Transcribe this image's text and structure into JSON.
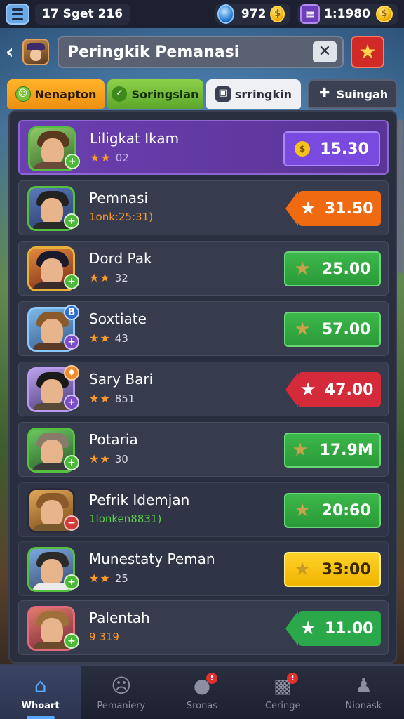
{
  "status_bar": {
    "title": "17 Sget 216",
    "gems": "972",
    "gold": "1:1980"
  },
  "header": {
    "search_value": "Peringkik Pemanasi",
    "clear_icon": "close-icon",
    "fav_icon": "star-icon"
  },
  "tabs": [
    {
      "label": "Nenapton",
      "icon": "smile-icon"
    },
    {
      "label": "Soringslan",
      "icon": "check-icon"
    },
    {
      "label": "srringkin",
      "icon": "grid-icon"
    },
    {
      "label": "Suingah",
      "icon": "plus-icon"
    }
  ],
  "rows": [
    {
      "name": "Liligkat Ikam",
      "sub": "★★ 02",
      "price": "15.30",
      "price_style": "purple",
      "sub_style": ""
    },
    {
      "name": "Pemnasi",
      "sub": "1onk:25:31)",
      "price": "31.50",
      "price_style": "orange-tag",
      "sub_style": "orange"
    },
    {
      "name": "Dord Pak",
      "sub": "★★ 32",
      "price": "25.00",
      "price_style": "green",
      "sub_style": ""
    },
    {
      "name": "Soxtiate",
      "sub": "★★ 43",
      "price": "57.00",
      "price_style": "green",
      "sub_style": ""
    },
    {
      "name": "Sary Bari",
      "sub": "★★ 851",
      "price": "47.00",
      "price_style": "red-tag",
      "sub_style": ""
    },
    {
      "name": "Potaria",
      "sub": "★★ 30",
      "price": "17.9M",
      "price_style": "green",
      "sub_style": ""
    },
    {
      "name": "Pefrik Idemjan",
      "sub": "1lonken8831)",
      "price": "20:60",
      "price_style": "green",
      "sub_style": "green"
    },
    {
      "name": "Munestaty Peman",
      "sub": "★★ 25",
      "price": "33:00",
      "price_style": "yellow",
      "sub_style": ""
    },
    {
      "name": "Palentah",
      "sub": "9 319",
      "price": "11.00",
      "price_style": "green-tag",
      "sub_style": "orange"
    }
  ],
  "bottom_nav": [
    {
      "label": "Whoart",
      "icon": "home-icon",
      "active": true
    },
    {
      "label": "Pemaniery",
      "icon": "face-icon",
      "active": false
    },
    {
      "label": "Sronas",
      "icon": "chat-icon",
      "active": false
    },
    {
      "label": "Ceringe",
      "icon": "shop-icon",
      "active": false
    },
    {
      "label": "Nionask",
      "icon": "user-icon",
      "active": false
    }
  ],
  "colors": {
    "accent": "#5aa8ff",
    "panel": "#2a2f3f",
    "highlight": "#6b3fb0"
  }
}
